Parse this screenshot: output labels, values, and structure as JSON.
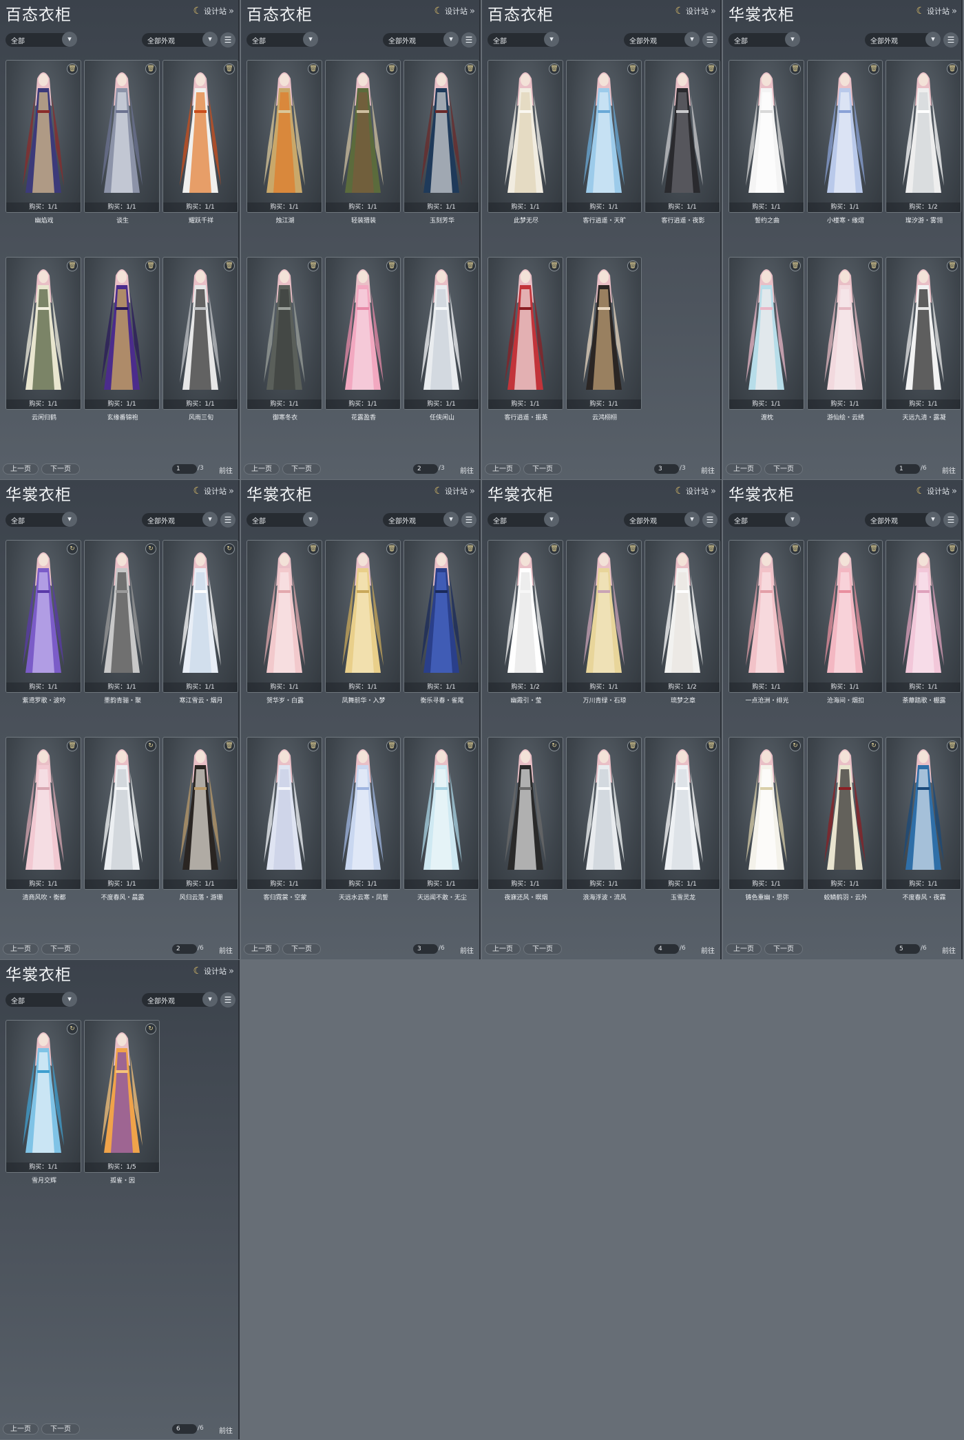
{
  "ui": {
    "design_label": "设计站",
    "filter_all": "全部",
    "filter_outfit": "全部外观",
    "prev": "上一页",
    "next": "下一页",
    "jump": "前往"
  },
  "colors": {
    "panel_bg": "#3f464e",
    "gold_accent": "#e5c56b",
    "card_border": "#70787f"
  },
  "panels": [
    {
      "title": "百态衣柜",
      "page": "1",
      "total": "/3",
      "cards": [
        {
          "name": "幽焰戏",
          "buy": "购买：1/1",
          "badge": "trash",
          "palette": [
            "#3c3a7a",
            "#e0c38a",
            "#8a2b2b"
          ]
        },
        {
          "name": "谈生",
          "buy": "购买：1/1",
          "badge": "trash",
          "palette": [
            "#8c93a8",
            "#d9dde6",
            "#6b7290"
          ]
        },
        {
          "name": "耀跃千祥",
          "buy": "购买：1/1",
          "badge": "trash",
          "palette": [
            "#f0f0ee",
            "#e37a2f",
            "#c94d1c"
          ]
        },
        {
          "name": "云闲归鹤",
          "buy": "购买：1/1",
          "badge": "trash",
          "palette": [
            "#e9e6cf",
            "#4c5a3a",
            "#f2efdf"
          ]
        },
        {
          "name": "玄缘番锦袍",
          "buy": "购买：1/1",
          "badge": "trash",
          "palette": [
            "#4b2c8c",
            "#d9b45a",
            "#2a1a5a"
          ]
        },
        {
          "name": "风雨三旬",
          "buy": "购买：1/1",
          "badge": "trash",
          "palette": [
            "#e7e7e7",
            "#2a2a2a",
            "#bfc2c5"
          ]
        }
      ]
    },
    {
      "title": "百态衣柜",
      "page": "2",
      "total": "/3",
      "cards": [
        {
          "name": "烛江湖",
          "buy": "购买：1/1",
          "badge": "trash",
          "palette": [
            "#c9a86a",
            "#e07a2a",
            "#d9c79a"
          ]
        },
        {
          "name": "轻装猎装",
          "buy": "购买：1/1",
          "badge": "trash",
          "palette": [
            "#5b6b3c",
            "#7a5a3c",
            "#cdbf9f"
          ]
        },
        {
          "name": "玉刻芳华",
          "buy": "购买：1/1",
          "badge": "trash",
          "palette": [
            "#1f3a5a",
            "#d7d7d7",
            "#6a2a2a"
          ]
        },
        {
          "name": "御寒冬衣",
          "buy": "购买：1/1",
          "badge": "trash",
          "palette": [
            "#5a5f5a",
            "#3a3f3c",
            "#9a9f9a"
          ]
        },
        {
          "name": "花露盈香",
          "buy": "购买：1/1",
          "badge": "trash",
          "palette": [
            "#f2a8c0",
            "#f7d7e2",
            "#e889a8"
          ]
        },
        {
          "name": "任侠闲山",
          "buy": "购买：1/1",
          "badge": "trash",
          "palette": [
            "#e9ecef",
            "#c9d2da",
            "#f5f7f9"
          ]
        }
      ]
    },
    {
      "title": "百态衣柜",
      "page": "3",
      "total": "/3",
      "cards": [
        {
          "name": "此梦无尽",
          "buy": "购买：1/1",
          "badge": "trash",
          "palette": [
            "#f1ece0",
            "#e0d4b6",
            "#faf7f0"
          ]
        },
        {
          "name": "客行逍遥・天旷",
          "buy": "购买：1/1",
          "badge": "trash",
          "palette": [
            "#9ccbea",
            "#d9eaf6",
            "#6aa9d7"
          ]
        },
        {
          "name": "客行逍遥・夜影",
          "buy": "购买：1/1",
          "badge": "trash",
          "palette": [
            "#2a2a2e",
            "#6a6a70",
            "#c9c9cc"
          ]
        },
        {
          "name": "客行逍遥・振英",
          "buy": "购买：1/1",
          "badge": "trash",
          "palette": [
            "#c2343a",
            "#f1e6e6",
            "#8a1f24"
          ]
        },
        {
          "name": "云鸿栩栩",
          "buy": "购买：1/1",
          "badge": "trash",
          "palette": [
            "#2b2624",
            "#c9a67a",
            "#e8d7c0"
          ]
        }
      ]
    },
    {
      "title": "华裳衣柜",
      "page": "1",
      "total": "/6",
      "cards": [
        {
          "name": "誓约之曲",
          "buy": "购买：1/1",
          "badge": "trash",
          "palette": [
            "#f4f4f4",
            "#ffffff",
            "#d9d9d9"
          ]
        },
        {
          "name": "小楼寒・缘熠",
          "buy": "购买：1/1",
          "badge": "trash",
          "palette": [
            "#b9c9ea",
            "#e9eef8",
            "#8aa2d6"
          ]
        },
        {
          "name": "璨汐游・雾翎",
          "buy": "购买：1/2",
          "badge": "trash",
          "palette": [
            "#eeeeee",
            "#d2d6d9",
            "#ffffff"
          ]
        },
        {
          "name": "渡枕",
          "buy": "购买：1/1",
          "badge": "trash",
          "palette": [
            "#b7dde9",
            "#f2eded",
            "#e9b7c7"
          ]
        },
        {
          "name": "游仙绘・云绣",
          "buy": "购买：1/1",
          "badge": "trash",
          "palette": [
            "#f2d9de",
            "#f7eaec",
            "#e5b9c2"
          ]
        },
        {
          "name": "天远九清・露凝",
          "buy": "购买：1/1",
          "badge": "trash",
          "palette": [
            "#f2f2f2",
            "#1f1f1f",
            "#e8e8e8"
          ]
        }
      ]
    },
    {
      "title": "华裳衣柜",
      "page": "2",
      "total": "/6",
      "cards": [
        {
          "name": "紫鸢罗歌・波吟",
          "buy": "购买：1/1",
          "badge": "refresh",
          "palette": [
            "#7b5cc8",
            "#c9b9ef",
            "#5a3aa8"
          ]
        },
        {
          "name": "墨韵青骊・聚",
          "buy": "购买：1/1",
          "badge": "refresh",
          "palette": [
            "#c8c8c8",
            "#4a4a4a",
            "#9a9a9a"
          ]
        },
        {
          "name": "寒江雪云・烟月",
          "buy": "购买：1/1",
          "badge": "refresh",
          "palette": [
            "#e8eef6",
            "#c9d9ea",
            "#ffffff"
          ]
        },
        {
          "name": "清商风吹・衡都",
          "buy": "购买：1/1",
          "badge": "trash",
          "palette": [
            "#f2c9d2",
            "#f7e6ea",
            "#d8a7b2"
          ]
        },
        {
          "name": "不度春风・晨露",
          "buy": "购买：1/1",
          "badge": "refresh",
          "palette": [
            "#eceff2",
            "#c9ced4",
            "#f7f9fa"
          ]
        },
        {
          "name": "风归云落・游珊",
          "buy": "购买：1/1",
          "badge": "trash",
          "palette": [
            "#2a2522",
            "#e9e4dc",
            "#b99a6a"
          ]
        }
      ]
    },
    {
      "title": "华裳衣柜",
      "page": "3",
      "total": "/6",
      "cards": [
        {
          "name": "贺华岁・白露",
          "buy": "购买：1/1",
          "badge": "trash",
          "palette": [
            "#f2c9cc",
            "#f9e7e8",
            "#e3a9ae"
          ]
        },
        {
          "name": "凤舞前华・入梦",
          "buy": "购买：1/1",
          "badge": "trash",
          "palette": [
            "#e9cf8a",
            "#f5e7be",
            "#c9a85a"
          ]
        },
        {
          "name": "衡乐寻春・雀尾",
          "buy": "购买：1/1",
          "badge": "trash",
          "palette": [
            "#2a3f8a",
            "#4a6ac8",
            "#1a2a5a"
          ]
        },
        {
          "name": "客归霓裳・空蒙",
          "buy": "购买：1/1",
          "badge": "trash",
          "palette": [
            "#dfe4f2",
            "#c8cfe6",
            "#f3f5fa"
          ]
        },
        {
          "name": "天远水云寒・凤誓",
          "buy": "购买：1/1",
          "badge": "trash",
          "palette": [
            "#c9d7f0",
            "#e9eff9",
            "#9fb5e0"
          ]
        },
        {
          "name": "天远闻不敢・无尘",
          "buy": "购买：1/1",
          "badge": "trash",
          "palette": [
            "#cfe9f2",
            "#eef7fa",
            "#a9d4e4"
          ]
        }
      ]
    },
    {
      "title": "华裳衣柜",
      "page": "4",
      "total": "/6",
      "cards": [
        {
          "name": "幽霞引・莹",
          "buy": "购买：1/2",
          "badge": "trash",
          "palette": [
            "#ffffff",
            "#e6e6e6",
            "#f7f7f7"
          ]
        },
        {
          "name": "万川青绿・石琼",
          "buy": "购买：1/1",
          "badge": "trash",
          "palette": [
            "#e8d59a",
            "#f2e6c2",
            "#c9a3b5"
          ]
        },
        {
          "name": "琉梦之章",
          "buy": "购买：1/2",
          "badge": "trash",
          "palette": [
            "#f2f2f0",
            "#e9e6df",
            "#ffffff"
          ]
        },
        {
          "name": "夜寐还风・暝烟",
          "buy": "购买：1/1",
          "badge": "refresh",
          "palette": [
            "#2a2a2a",
            "#e9e9e9",
            "#6a6a6a"
          ]
        },
        {
          "name": "浪海浮波・流风",
          "buy": "购买：1/1",
          "badge": "trash",
          "palette": [
            "#e9ecef",
            "#c9d1d8",
            "#f7f9fa"
          ]
        },
        {
          "name": "玉雪灵龙",
          "buy": "购买：1/1",
          "badge": "trash",
          "palette": [
            "#eef1f4",
            "#d7dde3",
            "#ffffff"
          ]
        }
      ]
    },
    {
      "title": "华裳衣柜",
      "page": "5",
      "total": "/6",
      "cards": [
        {
          "name": "一点沧洲・绯光",
          "buy": "购买：1/1",
          "badge": "trash",
          "palette": [
            "#f2c2c8",
            "#f9e3e6",
            "#e39fa8"
          ]
        },
        {
          "name": "沧海间・烟扣",
          "buy": "购买：1/1",
          "badge": "trash",
          "palette": [
            "#f3b7c2",
            "#fadde3",
            "#e9909f"
          ]
        },
        {
          "name": "荼蘼踏歌・棚露",
          "buy": "购买：1/1",
          "badge": "trash",
          "palette": [
            "#f2c7d9",
            "#f9e6ee",
            "#dfa1bc"
          ]
        },
        {
          "name": "铸色重幽・思弥",
          "buy": "购买：1/1",
          "badge": "refresh",
          "palette": [
            "#f4f2ea",
            "#ffffff",
            "#d9cfa9"
          ]
        },
        {
          "name": "蛟鳞鹤羽・云外",
          "buy": "购买：1/1",
          "badge": "refresh",
          "palette": [
            "#e9e4cf",
            "#2a2a2a",
            "#8a1f24"
          ]
        },
        {
          "name": "不度春风・夜霖",
          "buy": "购买：1/1",
          "badge": "trash",
          "palette": [
            "#2f6fa8",
            "#d7e3ee",
            "#1a4a7a"
          ]
        }
      ]
    },
    {
      "title": "华裳衣柜",
      "page": "6",
      "total": "/6",
      "cards": [
        {
          "name": "雪月交辉",
          "buy": "购买：1/1",
          "badge": "refresh",
          "palette": [
            "#7fc3e6",
            "#e9f4fa",
            "#3f9fcf"
          ]
        },
        {
          "name": "孤雀・因",
          "buy": "购买：1/5",
          "badge": "refresh",
          "palette": [
            "#f0a34a",
            "#7a4ab0",
            "#f5c27a"
          ]
        }
      ]
    }
  ]
}
